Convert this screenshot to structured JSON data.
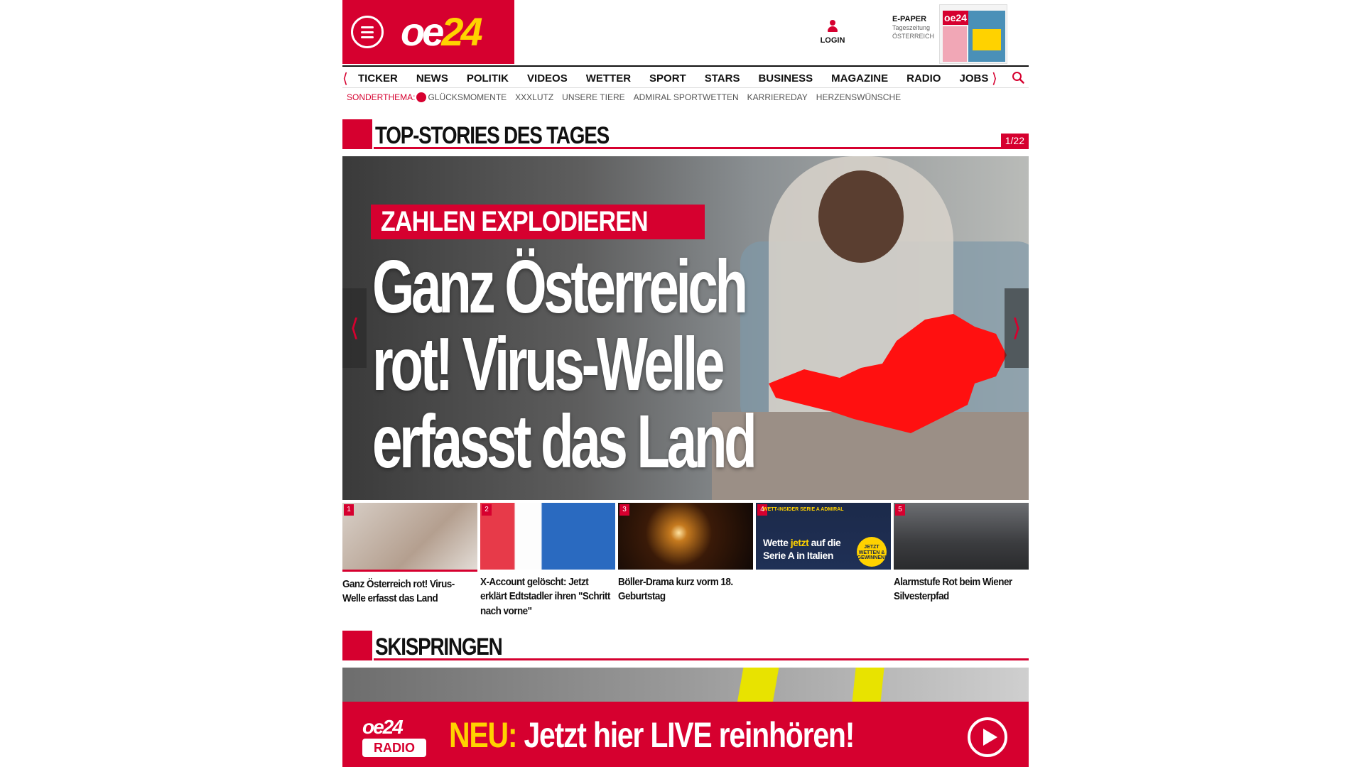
{
  "header": {
    "logo": "oe24",
    "login_label": "LOGIN",
    "epaper": {
      "title": "E-PAPER",
      "line1": "Tageszeitung",
      "line2": "ÖSTERREICH"
    }
  },
  "nav": {
    "items": [
      "TICKER",
      "NEWS",
      "POLITIK",
      "VIDEOS",
      "WETTER",
      "SPORT",
      "STARS",
      "BUSINESS",
      "MAGAZINE",
      "RADIO",
      "JOBS"
    ]
  },
  "subnav": {
    "label": "SONDERTHEMA:",
    "items": [
      "GLÜCKSMOMENTE",
      "XXXLUTZ",
      "UNSERE TIERE",
      "ADMIRAL SPORTWETTEN",
      "KARRIEREDAY",
      "HERZENSWÜNSCHE"
    ]
  },
  "top_stories": {
    "title": "TOP-STORIES DES TAGES",
    "counter": "1/22",
    "hero": {
      "kicker": "ZAHLEN EXPLODIEREN",
      "headline": "Ganz Österreich rot! Virus-Welle erfasst das Land"
    },
    "stories": [
      {
        "num": "1",
        "caption": "Ganz Österreich rot! Virus-Welle erfasst das Land"
      },
      {
        "num": "2",
        "caption": "X-Account gelöscht: Jetzt erklärt Edtstadler ihren \"Schritt nach vorne\""
      },
      {
        "num": "3",
        "caption": "Böller-Drama kurz vorm 18. Geburtstag"
      },
      {
        "num": "4",
        "caption": "",
        "ad": {
          "top": "WETT-INSIDER SERIE A ADMIRAL",
          "line1": "Wette ",
          "highlight": "jetzt",
          "line1b": " auf die",
          "line2": "Serie A in Italien",
          "badge": "JETZT WETTEN & GEWINNEN!"
        }
      },
      {
        "num": "5",
        "caption": "Alarmstufe Rot beim Wiener Silvesterpfad"
      }
    ]
  },
  "skispringen": {
    "title": "SKISPRINGEN"
  },
  "radio_banner": {
    "logo_top": "oe24",
    "logo_bottom": "RADIO",
    "neu": "NEU:",
    "text": " Jetzt hier LIVE reinhören!"
  },
  "colors": {
    "brand_red": "#d6002f",
    "accent_yellow": "#ffd200"
  }
}
